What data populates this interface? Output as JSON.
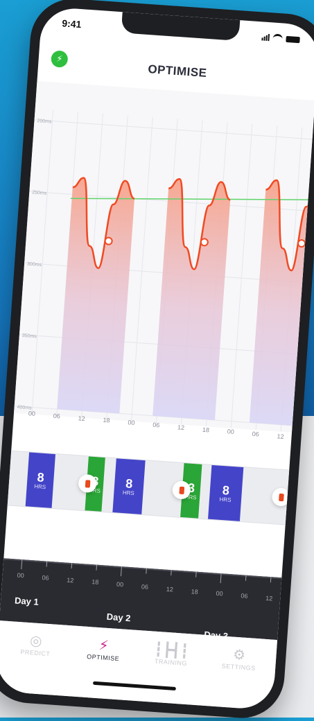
{
  "status_bar": {
    "time": "9:41"
  },
  "header": {
    "title": "OPTIMISE"
  },
  "chart_data": {
    "type": "line",
    "y_tick_labels": [
      "200ms",
      "250ms",
      "300ms",
      "350ms",
      "400ms"
    ],
    "ylim": [
      200,
      400
    ],
    "x_tick_labels": [
      "00",
      "06",
      "12",
      "18",
      "00",
      "06",
      "12",
      "18",
      "00",
      "06",
      "12"
    ],
    "reference_line": {
      "value": 250,
      "color": "#5fd36a"
    },
    "series": [
      {
        "values": [
          245,
          238,
          285,
          300,
          255,
          238,
          250
        ]
      },
      {
        "values": [
          245,
          238,
          285,
          300,
          255,
          238,
          250
        ]
      },
      {
        "values": [
          245,
          238,
          285,
          300,
          255,
          238,
          250
        ]
      }
    ],
    "colors": {
      "curve": "#f04a23",
      "fill_top": "#f7a48c",
      "fill_bottom": "#d9d6f6"
    }
  },
  "sleep": {
    "blocks": [
      {
        "num": "8",
        "unit": "HRS"
      },
      {
        "num": "8",
        "unit": "HRS"
      },
      {
        "num": "8",
        "unit": "HRS"
      }
    ],
    "naps": [
      {
        "num": "3",
        "unit": "HRS"
      },
      {
        "num": "3",
        "unit": "HRS"
      }
    ]
  },
  "timeline": {
    "labels": [
      "00",
      "06",
      "12",
      "18",
      "00",
      "06",
      "12",
      "18",
      "00",
      "06",
      "12"
    ],
    "days": [
      "Day 1",
      "Day 2",
      "Day 3"
    ]
  },
  "tabs": [
    {
      "label": "PREDICT",
      "icon": "target-icon"
    },
    {
      "label": "OPTIMISE",
      "icon": "bolt-icon"
    },
    {
      "label": "TRAINING",
      "icon": "dumbbell-icon"
    },
    {
      "label": "SETTINGS",
      "icon": "gear-icon"
    }
  ],
  "active_tab": "OPTIMISE"
}
